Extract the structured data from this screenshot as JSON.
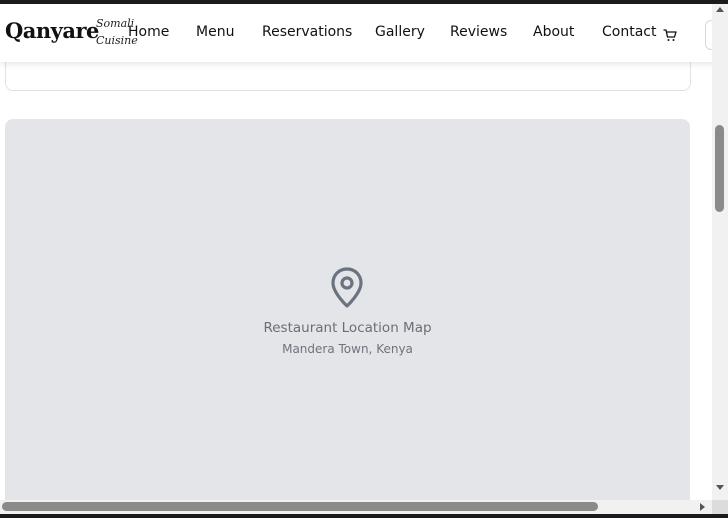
{
  "brand": {
    "name": "Qanyare",
    "tagline_line1": "Somali",
    "tagline_line2": "Cuisine"
  },
  "nav": {
    "items": [
      {
        "label": "Home"
      },
      {
        "label": "Menu"
      },
      {
        "label": "Reservations"
      },
      {
        "label": "Gallery"
      },
      {
        "label": "Reviews"
      },
      {
        "label": "About"
      },
      {
        "label": "Contact"
      }
    ],
    "cart_icon": "cart-icon"
  },
  "map": {
    "icon": "map-pin-icon",
    "title": "Restaurant Location Map",
    "subtitle": "Mandera Town, Kenya"
  },
  "colors": {
    "map_background": "#e4e5e9",
    "map_text": "#6a6e78",
    "pin": "#6b7280"
  }
}
